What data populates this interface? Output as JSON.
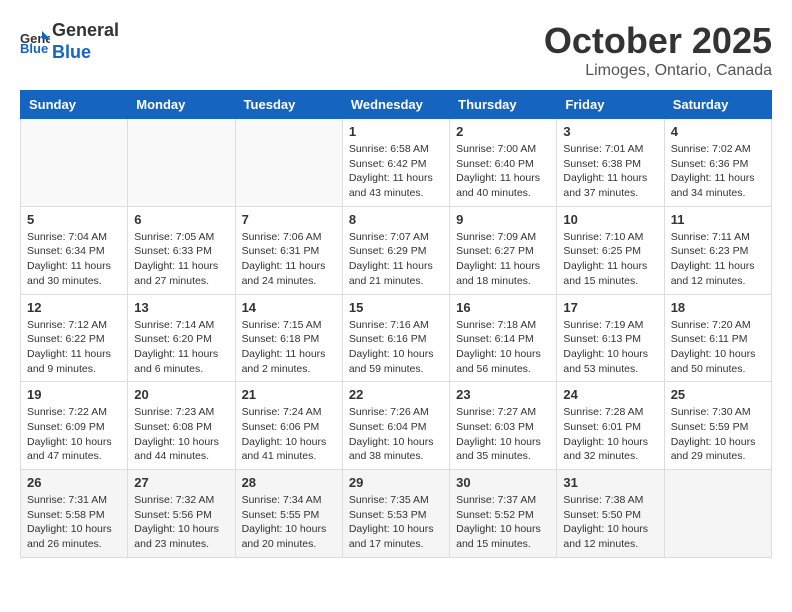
{
  "logo": {
    "line1": "General",
    "line2": "Blue"
  },
  "title": "October 2025",
  "subtitle": "Limoges, Ontario, Canada",
  "days_of_week": [
    "Sunday",
    "Monday",
    "Tuesday",
    "Wednesday",
    "Thursday",
    "Friday",
    "Saturday"
  ],
  "weeks": [
    [
      {
        "day": "",
        "info": ""
      },
      {
        "day": "",
        "info": ""
      },
      {
        "day": "",
        "info": ""
      },
      {
        "day": "1",
        "info": "Sunrise: 6:58 AM\nSunset: 6:42 PM\nDaylight: 11 hours\nand 43 minutes."
      },
      {
        "day": "2",
        "info": "Sunrise: 7:00 AM\nSunset: 6:40 PM\nDaylight: 11 hours\nand 40 minutes."
      },
      {
        "day": "3",
        "info": "Sunrise: 7:01 AM\nSunset: 6:38 PM\nDaylight: 11 hours\nand 37 minutes."
      },
      {
        "day": "4",
        "info": "Sunrise: 7:02 AM\nSunset: 6:36 PM\nDaylight: 11 hours\nand 34 minutes."
      }
    ],
    [
      {
        "day": "5",
        "info": "Sunrise: 7:04 AM\nSunset: 6:34 PM\nDaylight: 11 hours\nand 30 minutes."
      },
      {
        "day": "6",
        "info": "Sunrise: 7:05 AM\nSunset: 6:33 PM\nDaylight: 11 hours\nand 27 minutes."
      },
      {
        "day": "7",
        "info": "Sunrise: 7:06 AM\nSunset: 6:31 PM\nDaylight: 11 hours\nand 24 minutes."
      },
      {
        "day": "8",
        "info": "Sunrise: 7:07 AM\nSunset: 6:29 PM\nDaylight: 11 hours\nand 21 minutes."
      },
      {
        "day": "9",
        "info": "Sunrise: 7:09 AM\nSunset: 6:27 PM\nDaylight: 11 hours\nand 18 minutes."
      },
      {
        "day": "10",
        "info": "Sunrise: 7:10 AM\nSunset: 6:25 PM\nDaylight: 11 hours\nand 15 minutes."
      },
      {
        "day": "11",
        "info": "Sunrise: 7:11 AM\nSunset: 6:23 PM\nDaylight: 11 hours\nand 12 minutes."
      }
    ],
    [
      {
        "day": "12",
        "info": "Sunrise: 7:12 AM\nSunset: 6:22 PM\nDaylight: 11 hours\nand 9 minutes."
      },
      {
        "day": "13",
        "info": "Sunrise: 7:14 AM\nSunset: 6:20 PM\nDaylight: 11 hours\nand 6 minutes."
      },
      {
        "day": "14",
        "info": "Sunrise: 7:15 AM\nSunset: 6:18 PM\nDaylight: 11 hours\nand 2 minutes."
      },
      {
        "day": "15",
        "info": "Sunrise: 7:16 AM\nSunset: 6:16 PM\nDaylight: 10 hours\nand 59 minutes."
      },
      {
        "day": "16",
        "info": "Sunrise: 7:18 AM\nSunset: 6:14 PM\nDaylight: 10 hours\nand 56 minutes."
      },
      {
        "day": "17",
        "info": "Sunrise: 7:19 AM\nSunset: 6:13 PM\nDaylight: 10 hours\nand 53 minutes."
      },
      {
        "day": "18",
        "info": "Sunrise: 7:20 AM\nSunset: 6:11 PM\nDaylight: 10 hours\nand 50 minutes."
      }
    ],
    [
      {
        "day": "19",
        "info": "Sunrise: 7:22 AM\nSunset: 6:09 PM\nDaylight: 10 hours\nand 47 minutes."
      },
      {
        "day": "20",
        "info": "Sunrise: 7:23 AM\nSunset: 6:08 PM\nDaylight: 10 hours\nand 44 minutes."
      },
      {
        "day": "21",
        "info": "Sunrise: 7:24 AM\nSunset: 6:06 PM\nDaylight: 10 hours\nand 41 minutes."
      },
      {
        "day": "22",
        "info": "Sunrise: 7:26 AM\nSunset: 6:04 PM\nDaylight: 10 hours\nand 38 minutes."
      },
      {
        "day": "23",
        "info": "Sunrise: 7:27 AM\nSunset: 6:03 PM\nDaylight: 10 hours\nand 35 minutes."
      },
      {
        "day": "24",
        "info": "Sunrise: 7:28 AM\nSunset: 6:01 PM\nDaylight: 10 hours\nand 32 minutes."
      },
      {
        "day": "25",
        "info": "Sunrise: 7:30 AM\nSunset: 5:59 PM\nDaylight: 10 hours\nand 29 minutes."
      }
    ],
    [
      {
        "day": "26",
        "info": "Sunrise: 7:31 AM\nSunset: 5:58 PM\nDaylight: 10 hours\nand 26 minutes."
      },
      {
        "day": "27",
        "info": "Sunrise: 7:32 AM\nSunset: 5:56 PM\nDaylight: 10 hours\nand 23 minutes."
      },
      {
        "day": "28",
        "info": "Sunrise: 7:34 AM\nSunset: 5:55 PM\nDaylight: 10 hours\nand 20 minutes."
      },
      {
        "day": "29",
        "info": "Sunrise: 7:35 AM\nSunset: 5:53 PM\nDaylight: 10 hours\nand 17 minutes."
      },
      {
        "day": "30",
        "info": "Sunrise: 7:37 AM\nSunset: 5:52 PM\nDaylight: 10 hours\nand 15 minutes."
      },
      {
        "day": "31",
        "info": "Sunrise: 7:38 AM\nSunset: 5:50 PM\nDaylight: 10 hours\nand 12 minutes."
      },
      {
        "day": "",
        "info": ""
      }
    ]
  ]
}
